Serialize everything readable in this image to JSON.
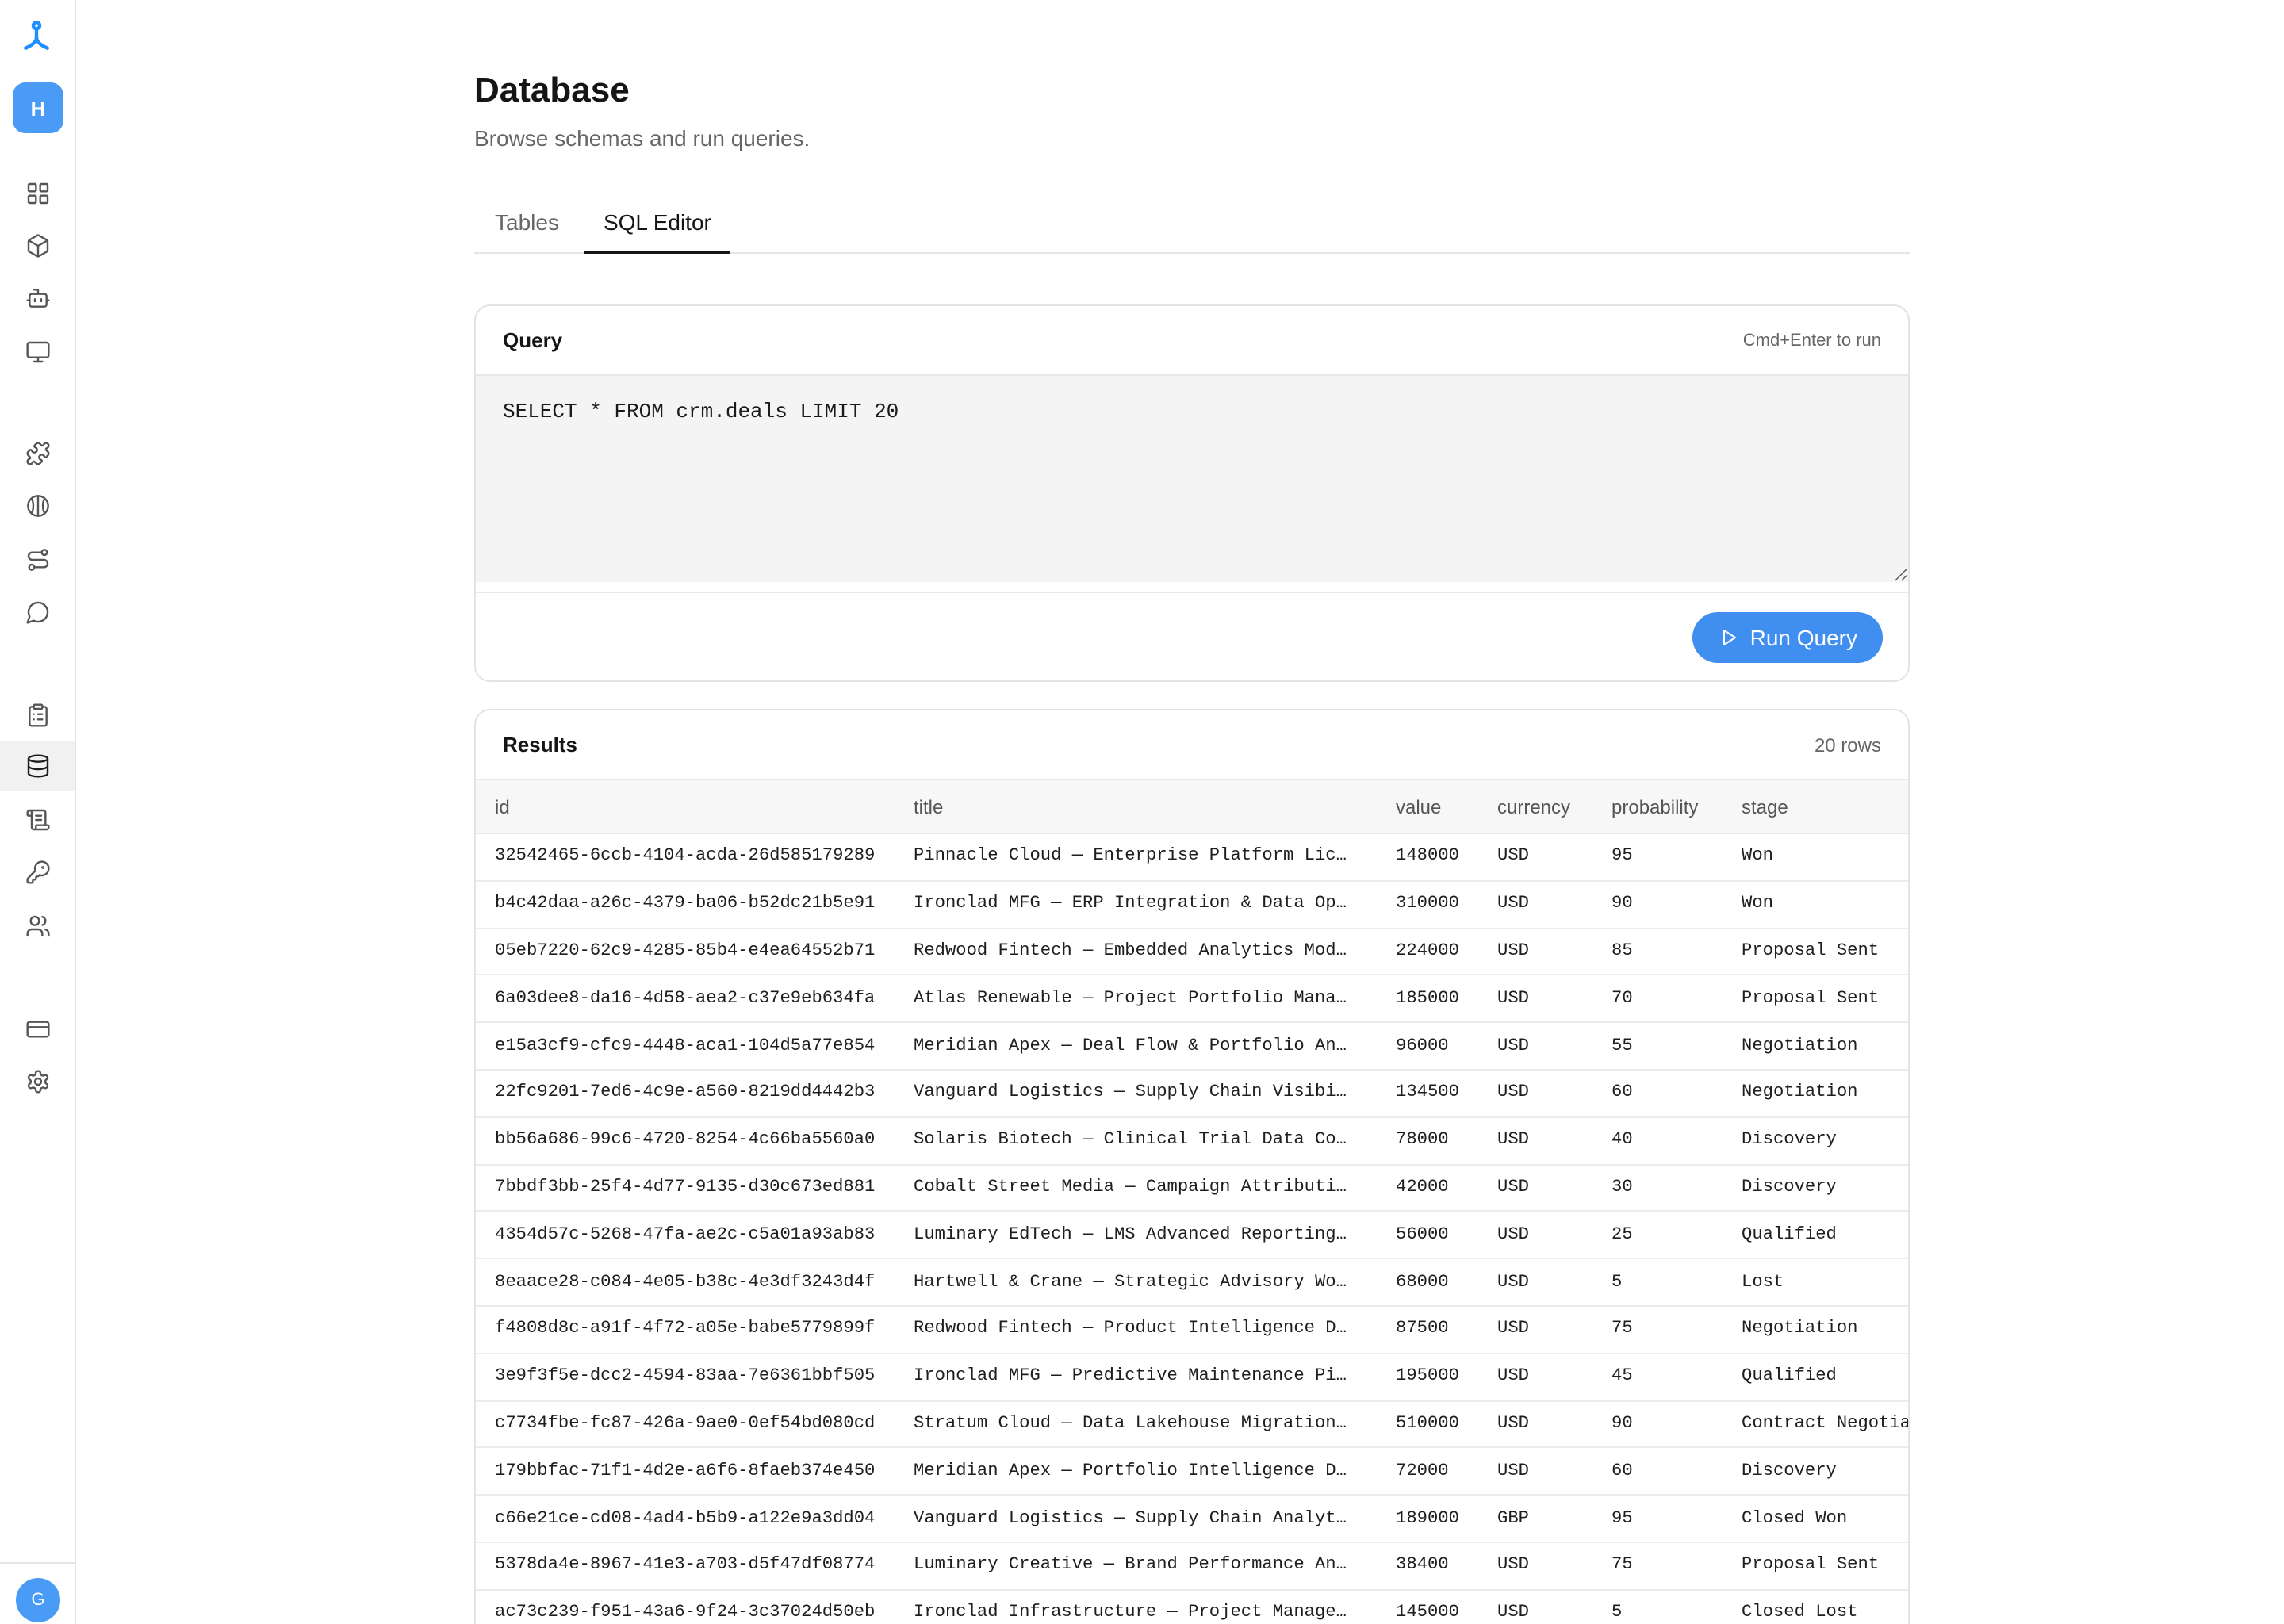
{
  "colors": {
    "accent": "#3f8ef0",
    "avatar": "#4a9bf6",
    "logo": "#1f8fff",
    "active_nav_bg": "#f1f1f1"
  },
  "sidebar": {
    "logo_icon": "logo-icon",
    "workspace_initial": "H",
    "user_initial": "G",
    "nav": [
      "grid-icon",
      "box-icon",
      "bot-icon",
      "monitor-icon",
      "puzzle-icon",
      "brain-icon",
      "route-icon",
      "message-circle-icon",
      "clipboard-list-icon",
      "database-icon",
      "scroll-text-icon",
      "key-icon",
      "users-icon",
      "credit-card-icon",
      "settings-icon"
    ],
    "active_icon": "database-icon"
  },
  "page": {
    "title": "Database",
    "subtitle": "Browse schemas and run queries."
  },
  "tabs": {
    "items": [
      {
        "label": "Tables"
      },
      {
        "label": "SQL Editor"
      }
    ],
    "active": "SQL Editor"
  },
  "query": {
    "label": "Query",
    "hint": "Cmd+Enter to run",
    "sql": "SELECT * FROM crm.deals LIMIT 20",
    "run_label": "Run Query",
    "run_icon": "play-icon"
  },
  "results": {
    "label": "Results",
    "count": "20 rows",
    "columns": [
      "id",
      "title",
      "value",
      "currency",
      "probability",
      "stage"
    ],
    "rows": [
      [
        "32542465-6ccb-4104-acda-26d585179289",
        "Pinnacle Cloud — Enterprise Platform Lic…",
        "148000",
        "USD",
        "95",
        "Won"
      ],
      [
        "b4c42daa-a26c-4379-ba06-b52dc21b5e91",
        "Ironclad MFG — ERP Integration & Data Op…",
        "310000",
        "USD",
        "90",
        "Won"
      ],
      [
        "05eb7220-62c9-4285-85b4-e4ea64552b71",
        "Redwood Fintech — Embedded Analytics Mod…",
        "224000",
        "USD",
        "85",
        "Proposal Sent"
      ],
      [
        "6a03dee8-da16-4d58-aea2-c37e9eb634fa",
        "Atlas Renewable — Project Portfolio Mana…",
        "185000",
        "USD",
        "70",
        "Proposal Sent"
      ],
      [
        "e15a3cf9-cfc9-4448-aca1-104d5a77e854",
        "Meridian Apex — Deal Flow & Portfolio An…",
        "96000",
        "USD",
        "55",
        "Negotiation"
      ],
      [
        "22fc9201-7ed6-4c9e-a560-8219dd4442b3",
        "Vanguard Logistics — Supply Chain Visibi…",
        "134500",
        "USD",
        "60",
        "Negotiation"
      ],
      [
        "bb56a686-99c6-4720-8254-4c66ba5560a0",
        "Solaris Biotech — Clinical Trial Data Co…",
        "78000",
        "USD",
        "40",
        "Discovery"
      ],
      [
        "7bbdf3bb-25f4-4d77-9135-d30c673ed881",
        "Cobalt Street Media — Campaign Attributi…",
        "42000",
        "USD",
        "30",
        "Discovery"
      ],
      [
        "4354d57c-5268-47fa-ae2c-c5a01a93ab83",
        "Luminary EdTech — LMS Advanced Reporting…",
        "56000",
        "USD",
        "25",
        "Qualified"
      ],
      [
        "8eaace28-c084-4e05-b38c-4e3df3243d4f",
        "Hartwell & Crane — Strategic Advisory Wo…",
        "68000",
        "USD",
        "5",
        "Lost"
      ],
      [
        "f4808d8c-a91f-4f72-a05e-babe5779899f",
        "Redwood Fintech — Product Intelligence D…",
        "87500",
        "USD",
        "75",
        "Negotiation"
      ],
      [
        "3e9f3f5e-dcc2-4594-83aa-7e6361bbf505",
        "Ironclad MFG — Predictive Maintenance Pi…",
        "195000",
        "USD",
        "45",
        "Qualified"
      ],
      [
        "c7734fbe-fc87-426a-9ae0-0ef54bd080cd",
        "Stratum Cloud — Data Lakehouse Migration…",
        "510000",
        "USD",
        "90",
        "Contract Negotia"
      ],
      [
        "179bbfac-71f1-4d2e-a6f6-8faeb374e450",
        "Meridian Apex — Portfolio Intelligence D…",
        "72000",
        "USD",
        "60",
        "Discovery"
      ],
      [
        "c66e21ce-cd08-4ad4-b5b9-a122e9a3dd04",
        "Vanguard Logistics — Supply Chain Analyt…",
        "189000",
        "GBP",
        "95",
        "Closed Won"
      ],
      [
        "5378da4e-8967-41e3-a703-d5f47df08774",
        "Luminary Creative — Brand Performance An…",
        "38400",
        "USD",
        "75",
        "Proposal Sent"
      ],
      [
        "ac73c239-f951-43a6-9f24-3c37024d50eb",
        "Ironclad Infrastructure — Project Manage…",
        "145000",
        "USD",
        "5",
        "Closed Lost"
      ]
    ]
  }
}
